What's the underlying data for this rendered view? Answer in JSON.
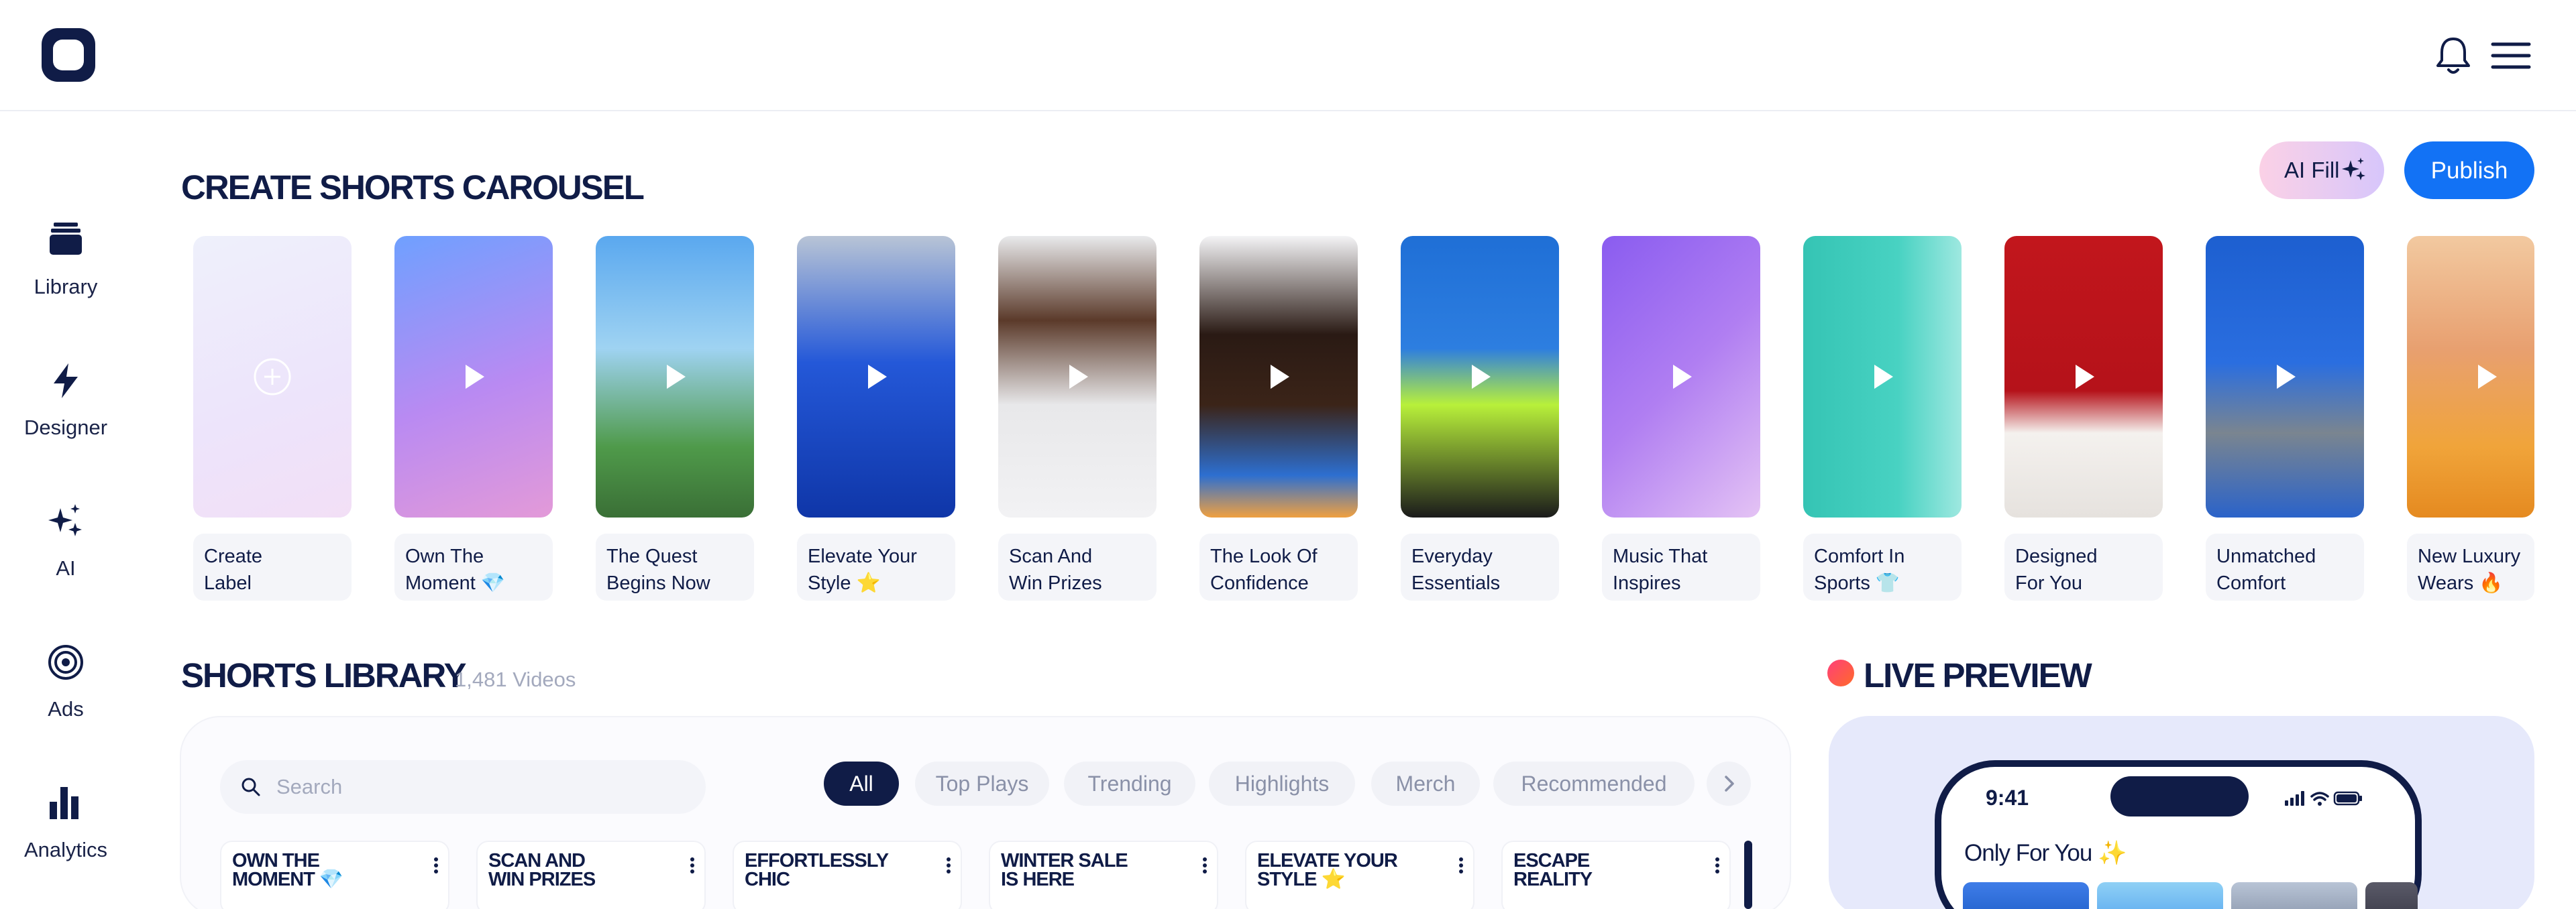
{
  "sidebar": {
    "items": [
      {
        "label": "Library",
        "icon": "library-icon"
      },
      {
        "label": "Designer",
        "icon": "bolt-icon"
      },
      {
        "label": "AI",
        "icon": "sparkles-icon"
      },
      {
        "label": "Ads",
        "icon": "target-icon"
      },
      {
        "label": "Analytics",
        "icon": "bar-chart-icon"
      }
    ]
  },
  "carousel": {
    "title": "CREATE SHORTS CAROUSEL",
    "ai_fill_label": "AI Fill",
    "publish_label": "Publish",
    "cards": [
      {
        "l1": "Create",
        "l2": "Label"
      },
      {
        "l1": "Own The",
        "l2": "Moment 💎"
      },
      {
        "l1": "The Quest",
        "l2": "Begins Now"
      },
      {
        "l1": "Elevate Your",
        "l2": "Style ⭐"
      },
      {
        "l1": "Scan And",
        "l2": "Win Prizes"
      },
      {
        "l1": "The Look Of",
        "l2": "Confidence"
      },
      {
        "l1": "Everyday",
        "l2": "Essentials"
      },
      {
        "l1": "Music That",
        "l2": "Inspires"
      },
      {
        "l1": "Comfort In",
        "l2": "Sports 👕"
      },
      {
        "l1": "Designed",
        "l2": "For You"
      },
      {
        "l1": "Unmatched",
        "l2": "Comfort"
      },
      {
        "l1": "New Luxury",
        "l2": "Wears 🔥"
      }
    ]
  },
  "library": {
    "title": "SHORTS LIBRARY",
    "count": "1,481 Videos",
    "search_placeholder": "Search",
    "filters": [
      "All",
      "Top Plays",
      "Trending",
      "Highlights",
      "Merch",
      "Recommended"
    ],
    "active_filter": "All",
    "videos": [
      {
        "l1": "OWN THE",
        "l2": "MOMENT 💎"
      },
      {
        "l1": "SCAN AND",
        "l2": "WIN PRIZES"
      },
      {
        "l1": "EFFORTLESSLY",
        "l2": "CHIC"
      },
      {
        "l1": "WINTER SALE",
        "l2": "IS HERE"
      },
      {
        "l1": "ELEVATE YOUR",
        "l2": "STYLE ⭐"
      },
      {
        "l1": "ESCAPE",
        "l2": "REALITY"
      }
    ]
  },
  "preview": {
    "title": "LIVE PREVIEW",
    "time": "9:41",
    "heading": "Only For You ✨"
  },
  "colors": {
    "brand_navy": "#101c47",
    "accent_blue": "#1272f5",
    "live_dot": "#ff3f7a"
  }
}
